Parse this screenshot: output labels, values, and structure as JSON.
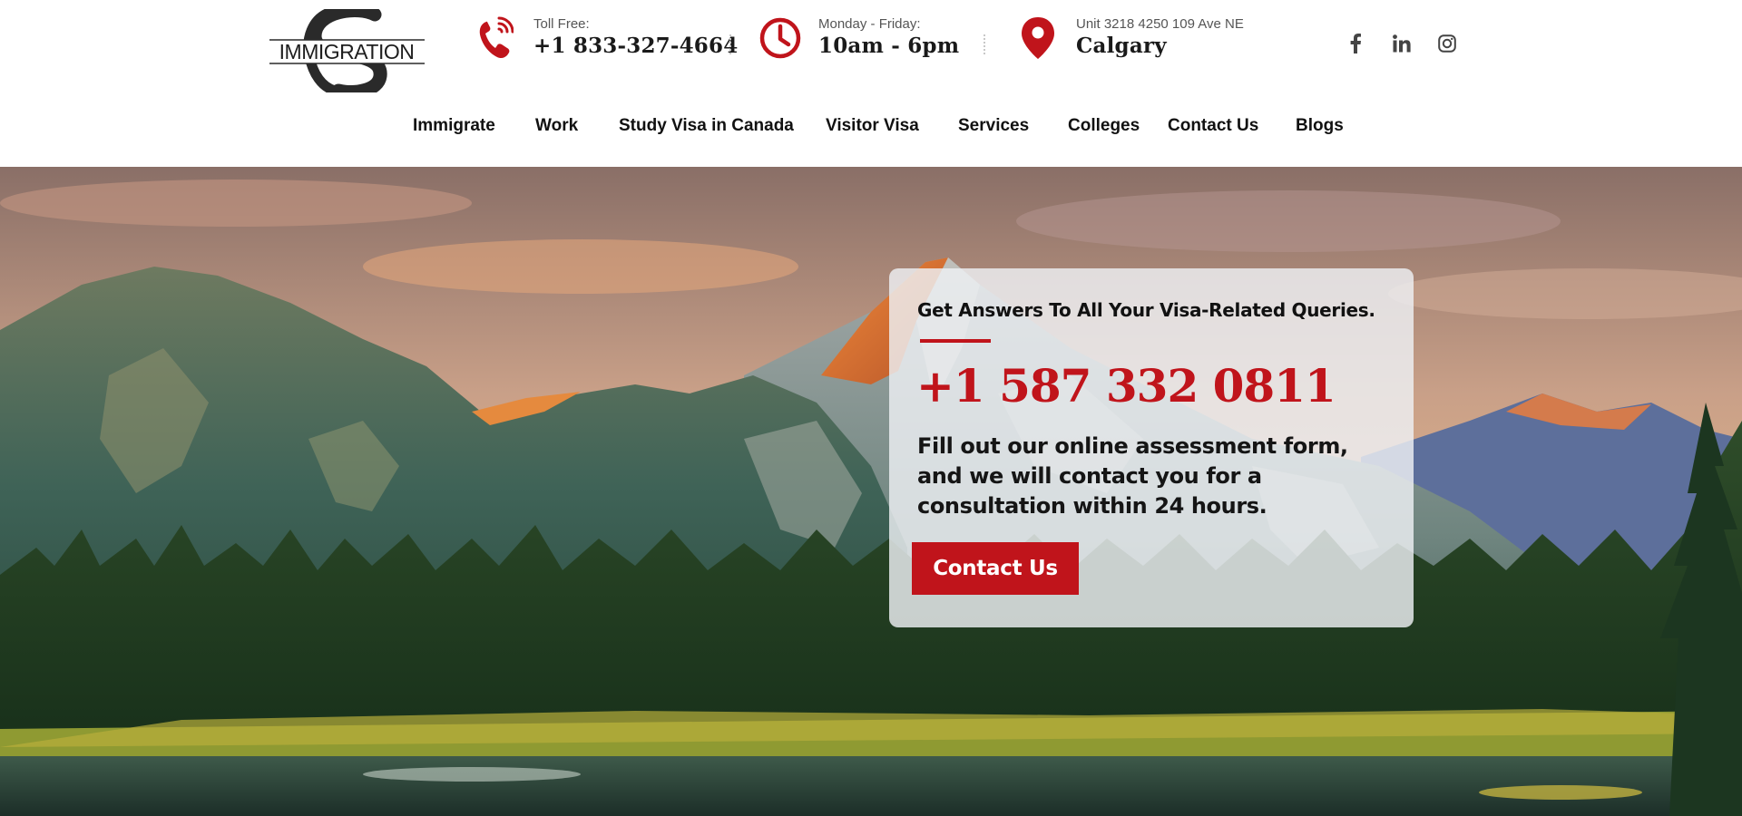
{
  "header": {
    "logo": {
      "text": "IMMIGRATION",
      "monogram": "S"
    },
    "phone": {
      "label": "Toll Free:",
      "value": "+1 833-327-4664",
      "icon": "phone-icon"
    },
    "hours": {
      "label": "Monday - Friday:",
      "value": "10am - 6pm",
      "icon": "clock-icon"
    },
    "address": {
      "label": "Unit 3218 4250 109 Ave NE",
      "value": "Calgary",
      "icon": "map-pin-icon"
    },
    "social": [
      "facebook-icon",
      "linkedin-icon",
      "instagram-icon"
    ]
  },
  "nav": {
    "items": [
      "Immigrate",
      "Work",
      "Study Visa in Canada",
      "Visitor Visa",
      "Services",
      "Colleges",
      "Contact Us",
      "Blogs"
    ]
  },
  "hero": {
    "card": {
      "kicker": "Get Answers To All Your Visa-Related Queries.",
      "phone": "+1 587 332 0811",
      "description": "Fill out our online assessment form, and we will contact you for a consultation within 24 hours.",
      "cta_label": "Contact Us"
    }
  },
  "colors": {
    "accent": "#c0141b",
    "text": "#111111",
    "muted": "#555555"
  }
}
